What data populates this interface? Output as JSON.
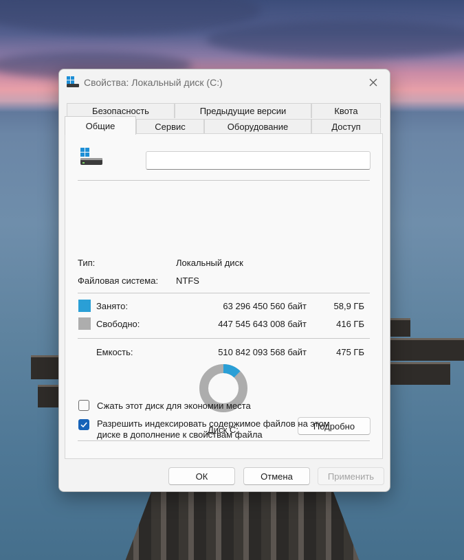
{
  "window": {
    "title": "Свойства: Локальный диск (C:)"
  },
  "tabs": {
    "row1": [
      "Безопасность",
      "Предыдущие версии",
      "Квота"
    ],
    "row2": [
      "Общие",
      "Сервис",
      "Оборудование",
      "Доступ"
    ],
    "active": "Общие"
  },
  "general": {
    "drive_name_value": "",
    "type_label": "Тип:",
    "type_value": "Локальный диск",
    "fs_label": "Файловая система:",
    "fs_value": "NTFS",
    "used": {
      "label": "Занято:",
      "bytes": "63 296 450 560 байт",
      "size": "58,9 ГБ",
      "color": "#2a9fd6"
    },
    "free": {
      "label": "Свободно:",
      "bytes": "447 545 643 008 байт",
      "size": "416 ГБ",
      "color": "#adadad"
    },
    "capacity": {
      "label": "Емкость:",
      "bytes": "510 842 093 568 байт",
      "size": "475 ГБ"
    },
    "used_fraction": 0.124,
    "disk_label": "Диск C:",
    "details_button": "Подробно",
    "compress_label": "Сжать этот диск для экономии места",
    "compress_checked": false,
    "index_label_line1": "Разрешить индексировать содержимое файлов на этом",
    "index_label_line2": "диске в дополнение к свойствам файла",
    "index_checked": true
  },
  "footer": {
    "ok": "ОК",
    "cancel": "Отмена",
    "apply": "Применить"
  },
  "icons": {
    "title": "drive-icon",
    "close": "close-icon",
    "check": "check-icon"
  }
}
